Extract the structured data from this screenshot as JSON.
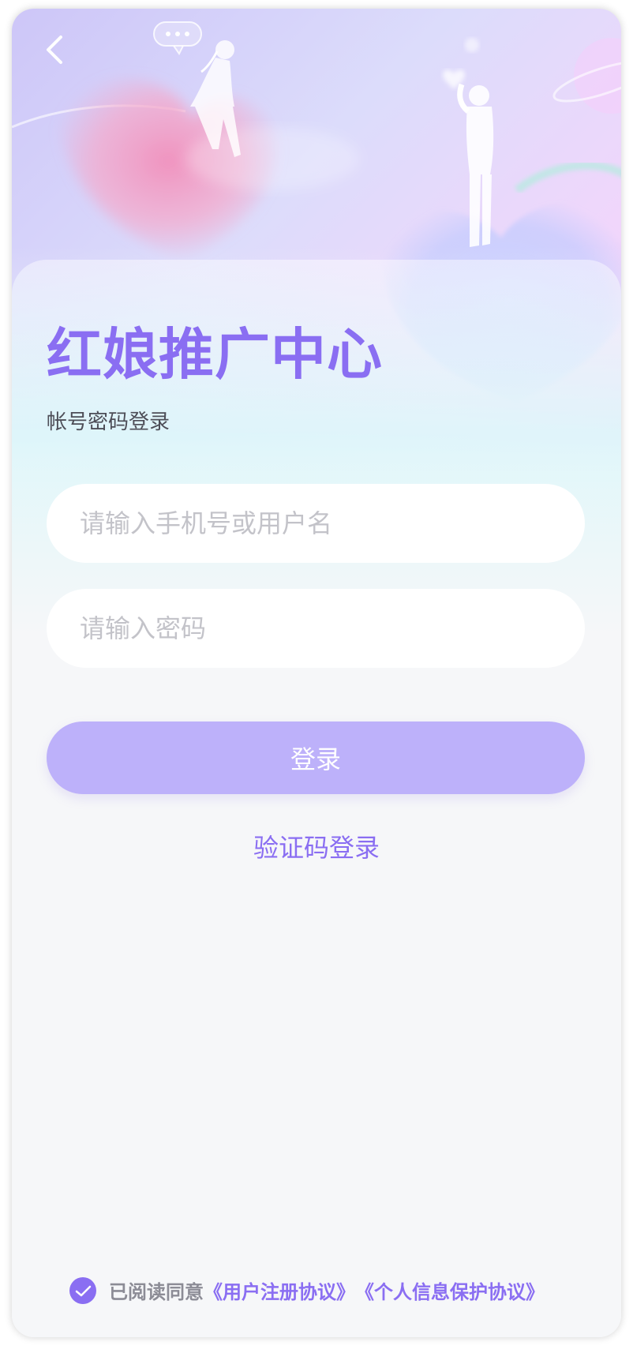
{
  "header": {
    "back_icon": "chevron-left-icon",
    "title": "红娘推广中心",
    "subtitle": "帐号密码登录"
  },
  "form": {
    "username_placeholder": "请输入手机号或用户名",
    "username_value": "",
    "password_placeholder": "请输入密码",
    "password_value": "",
    "login_label": "登录",
    "code_login_label": "验证码登录"
  },
  "agreement": {
    "checked": true,
    "prefix": "已阅读同意",
    "user_agreement": "《用户注册协议》",
    "privacy_agreement": "《个人信息保护协议》"
  },
  "colors": {
    "accent": "#8a6ef2",
    "button_bg": "#bdb1fa",
    "page_bg": "#f6f7f9"
  }
}
